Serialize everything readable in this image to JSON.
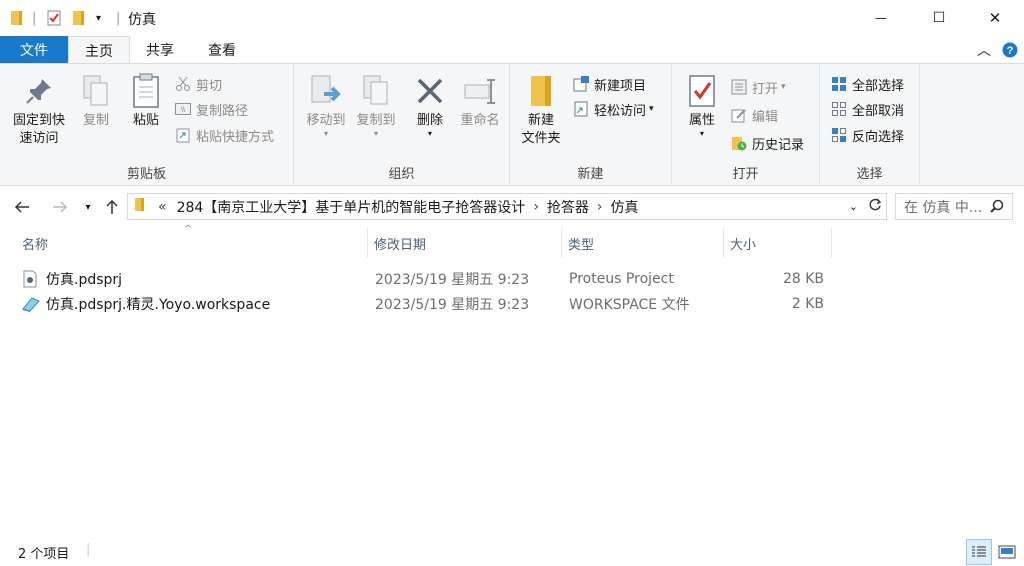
{
  "window": {
    "title": "仿真",
    "minimize_glyph": "—",
    "maximize_glyph": "☐",
    "close_glyph": "✕"
  },
  "tabs": [
    {
      "label": "文件"
    },
    {
      "label": "主页"
    },
    {
      "label": "共享"
    },
    {
      "label": "查看"
    }
  ],
  "ribbon": {
    "clipboard": {
      "label": "剪贴板",
      "pin": "固定到快\n速访问",
      "copy": "复制",
      "paste": "粘贴",
      "cut": "剪切",
      "copy_path": "复制路径",
      "paste_shortcut": "粘贴快捷方式"
    },
    "organize": {
      "label": "组织",
      "move_to": "移动到",
      "copy_to": "复制到",
      "delete": "删除",
      "rename": "重命名"
    },
    "new": {
      "label": "新建",
      "new_folder": "新建\n文件夹",
      "new_item": "新建项目",
      "easy_access": "轻松访问"
    },
    "open": {
      "label": "打开",
      "properties": "属性",
      "open": "打开",
      "edit": "编辑",
      "history": "历史记录"
    },
    "select": {
      "label": "选择",
      "select_all": "全部选择",
      "select_none": "全部取消",
      "invert": "反向选择"
    }
  },
  "address": {
    "overflow": "«",
    "crumbs": [
      "284【南京工业大学】基于单片机的智能电子抢答器设计",
      "抢答器",
      "仿真"
    ],
    "separator": "›",
    "search_placeholder": "在 仿真 中..."
  },
  "columns": {
    "name": "名称",
    "date": "修改日期",
    "type": "类型",
    "size": "大小"
  },
  "files": [
    {
      "name": "仿真.pdsprj",
      "date": "2023/5/19 星期五 9:23",
      "type": "Proteus Project",
      "size": "28 KB",
      "icon": "proteus-file-icon"
    },
    {
      "name": "仿真.pdsprj.精灵.Yoyo.workspace",
      "date": "2023/5/19 星期五 9:23",
      "type": "WORKSPACE 文件",
      "size": "2 KB",
      "icon": "workspace-file-icon"
    }
  ],
  "status": {
    "count": "2 个项目"
  },
  "colors": {
    "accent": "#1979ca",
    "folder": "#f2c34c"
  }
}
